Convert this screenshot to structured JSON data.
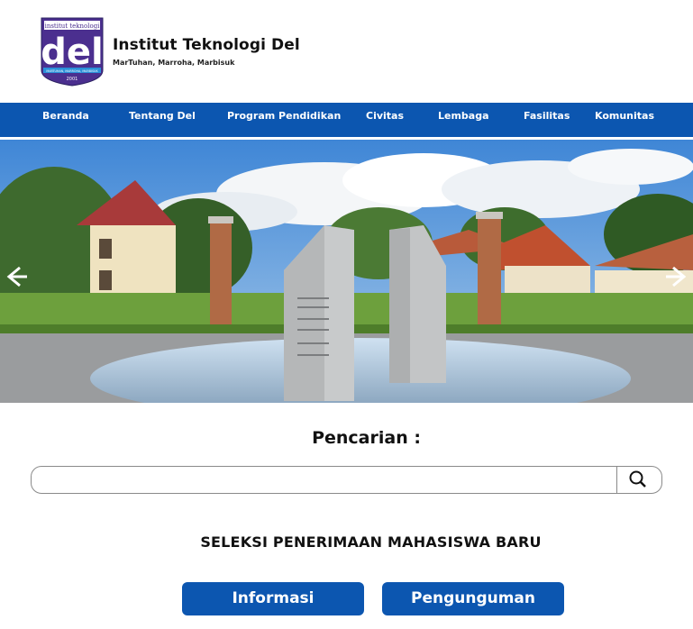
{
  "header": {
    "logo_text": "institut teknologi",
    "logo_mark": "del",
    "logo_ribbon": "MARTUHAN, MARROHA, MARBISUK",
    "logo_year": "2001",
    "title": "Institut Teknologi Del",
    "tagline": "MarTuhan, Marroha, Marbisuk"
  },
  "nav": {
    "items": [
      {
        "label": "Beranda"
      },
      {
        "label": "Tentang Del"
      },
      {
        "label": "Program Pendidikan"
      },
      {
        "label": "Civitas"
      },
      {
        "label": "Lembaga"
      },
      {
        "label": "Fasilitas"
      },
      {
        "label": "Komunitas"
      }
    ]
  },
  "hero": {
    "prev_icon": "chevron-left-icon",
    "next_icon": "chevron-right-icon"
  },
  "search": {
    "title": "Pencarian :",
    "placeholder": "",
    "icon": "search-icon"
  },
  "section": {
    "title": "SELEKSI PENERIMAAN MAHASISWA BARU",
    "buttons": {
      "info": "Informasi",
      "announce": "Pengunguman"
    }
  },
  "colors": {
    "primary": "#0c56b0",
    "logo_purple": "#4b2f8f",
    "logo_blue": "#2a8fd8"
  }
}
